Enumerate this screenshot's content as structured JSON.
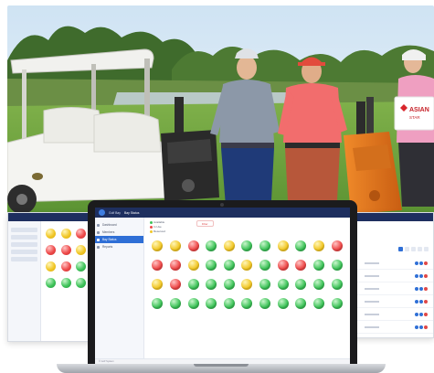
{
  "photo": {
    "sign_text": "ASIAN",
    "sign_subtext": "STAR"
  },
  "app": {
    "tabs": [
      {
        "label": "Golf Bay"
      },
      {
        "label": "Bay Status"
      }
    ],
    "sidebar": [
      {
        "label": "Dashboard"
      },
      {
        "label": "Members"
      },
      {
        "label": "Bay Status"
      },
      {
        "label": "Reports"
      }
    ],
    "sidebar_active_index": 2,
    "legend": [
      {
        "label": "Available",
        "color": "#3fc35a"
      },
      {
        "label": "In Use",
        "color": "#ee4a4a"
      },
      {
        "label": "Reserved",
        "color": "#f1c727"
      }
    ],
    "filter_label": "Filter",
    "footer": "© Golf System",
    "bay_rows": [
      [
        "y",
        "y",
        "r",
        "g",
        "y",
        "g",
        "g",
        "y",
        "g",
        "y",
        "r"
      ],
      [
        "r",
        "r",
        "y",
        "g",
        "g",
        "y",
        "g",
        "r",
        "r",
        "g",
        "g"
      ],
      [
        "y",
        "r",
        "g",
        "g",
        "g",
        "y",
        "g",
        "g",
        "g",
        "g",
        "g"
      ],
      [
        "g",
        "g",
        "g",
        "g",
        "g",
        "g",
        "g",
        "g",
        "g",
        "g",
        "g"
      ]
    ]
  },
  "screen_left": {
    "bay_rows": [
      [
        "y",
        "y",
        "r",
        "y"
      ],
      [
        "r",
        "r",
        "y",
        "g"
      ],
      [
        "y",
        "r",
        "g",
        "g"
      ],
      [
        "g",
        "g",
        "g",
        "g"
      ]
    ]
  },
  "screen_right": {
    "row_count": 7
  },
  "colors": {
    "navy": "#1e2f5f",
    "accent": "#2f6fd6",
    "available": "#3fc35a",
    "in_use": "#ee4a4a",
    "reserved": "#f1c727"
  }
}
